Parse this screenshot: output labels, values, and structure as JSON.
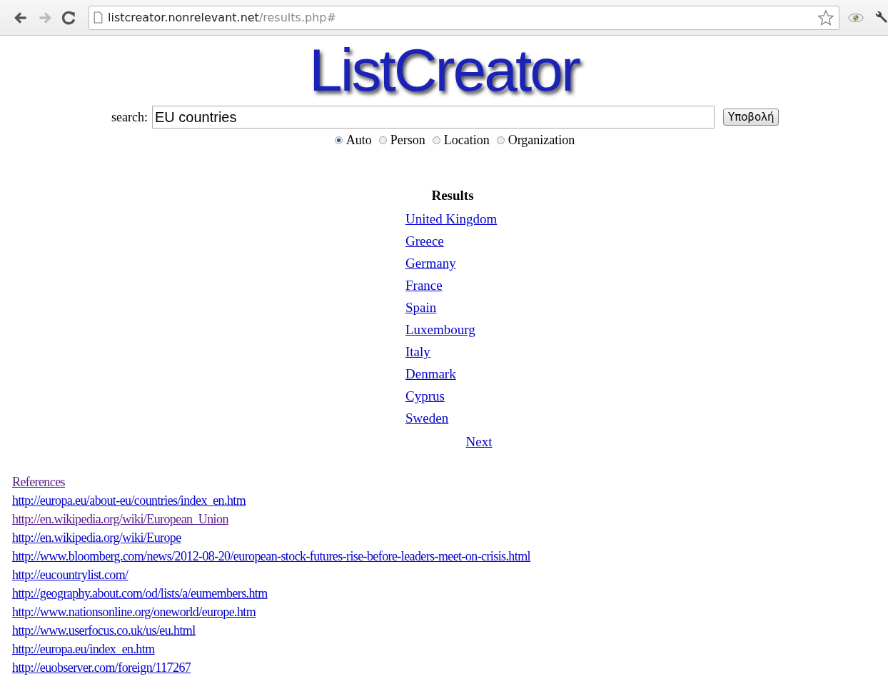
{
  "browser": {
    "address": {
      "host": "listcreator.nonrelevant.net",
      "path": "/results.php#"
    }
  },
  "logo": "ListCreator",
  "search": {
    "label": "search:",
    "value": "EU countries",
    "submit": "Υποβολή"
  },
  "types": [
    {
      "label": "Auto",
      "selected": true
    },
    {
      "label": "Person",
      "selected": false
    },
    {
      "label": "Location",
      "selected": false
    },
    {
      "label": "Organization",
      "selected": false
    }
  ],
  "results": {
    "title": "Results",
    "items": [
      "United Kingdom",
      "Greece",
      "Germany",
      "France",
      "Spain",
      "Luxembourg",
      "Italy",
      "Denmark",
      "Cyprus",
      "Sweden"
    ],
    "next": "Next"
  },
  "references": {
    "title": "References",
    "title_visited": true,
    "links": [
      {
        "url": "http://europa.eu/about-eu/countries/index_en.htm",
        "visited": false
      },
      {
        "url": "http://en.wikipedia.org/wiki/European_Union",
        "visited": true
      },
      {
        "url": "http://en.wikipedia.org/wiki/Europe",
        "visited": false
      },
      {
        "url": "http://www.bloomberg.com/news/2012-08-20/european-stock-futures-rise-before-leaders-meet-on-crisis.html",
        "visited": false
      },
      {
        "url": "http://eucountrylist.com/",
        "visited": false
      },
      {
        "url": "http://geography.about.com/od/lists/a/eumembers.htm",
        "visited": false
      },
      {
        "url": "http://www.nationsonline.org/oneworld/europe.htm",
        "visited": false
      },
      {
        "url": "http://www.userfocus.co.uk/us/eu.html",
        "visited": false
      },
      {
        "url": "http://europa.eu/index_en.htm",
        "visited": false
      },
      {
        "url": "http://euobserver.com/foreign/117267",
        "visited": false
      }
    ]
  }
}
